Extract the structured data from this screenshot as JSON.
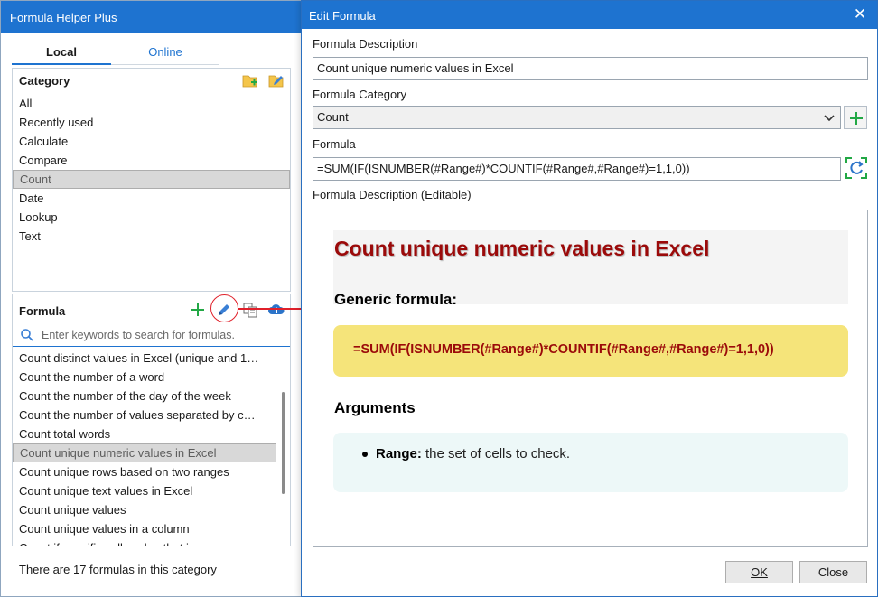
{
  "left_pane": {
    "title": "Formula Helper Plus",
    "tabs": [
      {
        "label": "Local",
        "active": true
      },
      {
        "label": "Online",
        "active": false
      }
    ],
    "category": {
      "header": "Category",
      "items": [
        "All",
        "Recently used",
        "Calculate",
        "Compare",
        "Count",
        "Date",
        "Lookup",
        "Text"
      ],
      "selected": "Count"
    },
    "formula": {
      "header": "Formula",
      "search_placeholder": "Enter keywords to search for formulas.",
      "items": [
        "Count distinct values in Excel (unique and 1…",
        "Count the number of a word",
        "Count the number of the day of the week",
        "Count the number of values separated by c…",
        "Count total words",
        "Count unique numeric values in Excel",
        "Count unique rows based on two ranges",
        "Count unique text values in Excel",
        "Count unique values",
        "Count unique values in a column",
        "Count if specific cells value that is..."
      ],
      "selected": "Count unique numeric values in Excel"
    },
    "status": "There are 17 formulas in this category",
    "icons": [
      "add-category-icon",
      "edit-category-icon",
      "add-formula-icon",
      "edit-formula-icon",
      "copy-formula-icon",
      "cloud-upload-icon",
      "search-icon"
    ]
  },
  "dialog": {
    "title": "Edit Formula",
    "description_label": "Formula Description",
    "description_value": "Count unique numeric values in Excel",
    "category_label": "Formula Category",
    "category_value": "Count",
    "formula_label": "Formula",
    "formula_value": "=SUM(IF(ISNUMBER(#Range#)*COUNTIF(#Range#,#Range#)=1,1,0))",
    "editable_label": "Formula Description (Editable)",
    "preview": {
      "title": "Count unique numeric values in Excel",
      "generic_heading": "Generic formula:",
      "generic_formula": "=SUM(IF(ISNUMBER(#Range#)*COUNTIF(#Range#,#Range#)=1,1,0))",
      "arguments_heading": "Arguments",
      "argument_name": "Range:",
      "argument_text": " the set of cells to check."
    },
    "ok_label": "OK",
    "close_label": "Close"
  },
  "colors": {
    "titlebar": "#1e73d0",
    "accent_green": "#22a845",
    "highlight_red": "#e0202a",
    "preview_title": "#9b0a0a",
    "formula_box": "#f5e47a",
    "args_box": "#edf8f8"
  }
}
